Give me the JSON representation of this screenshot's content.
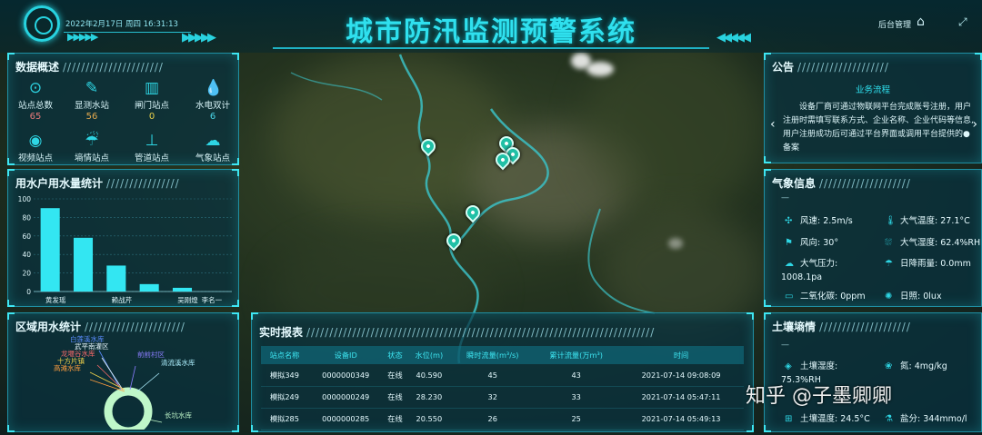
{
  "header": {
    "datetime": "2022年2月17日 周四 16:31:13",
    "title": "城市防汛监测预警系统",
    "backend_label": "后台管理",
    "chevrons_left_a": "▶▶▶▶▶",
    "chevrons_left_b": "▶▶▶▶▶",
    "chevrons_right": "◀◀◀◀◀"
  },
  "overview": {
    "title": "数据概述",
    "slashes": "//////////////////////",
    "items": [
      {
        "label": "站点总数",
        "value": "65",
        "color": "#e6797a",
        "icon": "location-pin-icon"
      },
      {
        "label": "显测水站",
        "value": "56",
        "color": "#e2a84e",
        "icon": "tool-icon"
      },
      {
        "label": "闸门站点",
        "value": "0",
        "color": "#e8d04a",
        "icon": "gate-icon"
      },
      {
        "label": "水电双计",
        "value": "6",
        "color": "#4ad6e8",
        "icon": "water-drop-icon"
      },
      {
        "label": "视频站点",
        "value": "",
        "color": "",
        "icon": "video-pin-icon"
      },
      {
        "label": "墒情站点",
        "value": "",
        "color": "",
        "icon": "sprinkler-icon"
      },
      {
        "label": "管道站点",
        "value": "",
        "color": "",
        "icon": "pipe-icon"
      },
      {
        "label": "气象站点",
        "value": "",
        "color": "",
        "icon": "weather-icon"
      }
    ]
  },
  "water_usage": {
    "title": "用水户用水量统计",
    "slashes": "////////////////"
  },
  "chart_data": {
    "type": "bar",
    "title": "用水户用水量统计",
    "categories": [
      "黄发瑶",
      "",
      "赖战芹",
      "",
      "吴刚煌",
      "李名一"
    ],
    "values": [
      90,
      58,
      28,
      8,
      4,
      0
    ],
    "ylim": [
      0,
      100
    ],
    "yticks": [
      0,
      20,
      40,
      60,
      80,
      100
    ],
    "grid": true,
    "bar_color": "#33e6f2"
  },
  "region": {
    "title": "区域用水统计",
    "slashes": "//////////////////////",
    "labels": [
      {
        "text": "白莲溪水库",
        "color": "#5b8cff"
      },
      {
        "text": "武平南灌区",
        "color": "#e9f7ff"
      },
      {
        "text": "龙堰谷水库",
        "color": "#ff6b6b"
      },
      {
        "text": "十方片镇",
        "color": "#f1d24c"
      },
      {
        "text": "高滩水库",
        "color": "#ff9e3e"
      },
      {
        "text": "前前村区",
        "color": "#8a7dff"
      },
      {
        "text": "清流溪水库",
        "color": "#aef0ff"
      },
      {
        "text": "长坑水库",
        "color": "#bff7c9"
      }
    ]
  },
  "report": {
    "title": "实时报表",
    "slashes": "////////////////////////////////////////////////////////////////////////////",
    "columns": [
      "站点名称",
      "设备ID",
      "状态",
      "水位(m)",
      "瞬时流量(m³/s)",
      "累计流量(万m³)",
      "时间"
    ],
    "rows": [
      [
        "模拟349",
        "0000000349",
        "在线",
        "40.590",
        "45",
        "43",
        "2021-07-14 09:08:09"
      ],
      [
        "模拟249",
        "0000000249",
        "在线",
        "28.230",
        "32",
        "33",
        "2021-07-14 05:47:11"
      ],
      [
        "模拟285",
        "0000000285",
        "在线",
        "20.550",
        "26",
        "25",
        "2021-07-14 05:49:13"
      ]
    ]
  },
  "notice": {
    "title": "公告",
    "slashes": "////////////////////",
    "subtitle": "业务流程",
    "body": "设备厂商可通过物联网平台完成账号注册，用户注册时需填写联系方式、企业名称、企业代码等信息,用户注册成功后可通过平台界面或调用平台提供的●备案",
    "prev": "‹",
    "next": "›"
  },
  "weather": {
    "title": "气象信息",
    "slashes": "////////////////////",
    "dash": "—",
    "rows": [
      {
        "label": "风速:",
        "value": "2.5m/s",
        "icon": "wind-icon"
      },
      {
        "label": "大气温度:",
        "value": "27.1°C",
        "icon": "thermometer-icon"
      },
      {
        "label": "风向:",
        "value": "30°",
        "icon": "wind-direction-icon"
      },
      {
        "label": "大气湿度:",
        "value": "62.4%RH",
        "icon": "humidity-icon"
      },
      {
        "label": "大气压力:",
        "value": "",
        "icon": "pressure-icon"
      },
      {
        "label": "日降雨量:",
        "value": "0.0mm",
        "icon": "rain-icon"
      },
      {
        "label": "二氧化碳:",
        "value": "0ppm",
        "icon": "co2-icon"
      },
      {
        "label": "日照:",
        "value": "0lux",
        "icon": "sun-icon"
      }
    ],
    "pressure_value": "1008.1pa"
  },
  "soil": {
    "title": "土壤墒情",
    "slashes": "////////////////////",
    "dash": "—",
    "rows": [
      {
        "label": "土壤湿度:",
        "value": "",
        "icon": "soil-moisture-icon"
      },
      {
        "label": "氮:",
        "value": "4mg/kg",
        "icon": "nitrogen-icon"
      },
      {
        "label": "土壤温度:",
        "value": "24.5°C",
        "icon": "soil-temp-icon"
      },
      {
        "label": "盐分:",
        "value": "344mmo/l",
        "icon": "salt-icon"
      }
    ],
    "moisture_value": "75.3%RH"
  },
  "watermark": "知乎 @子墨卿卿"
}
